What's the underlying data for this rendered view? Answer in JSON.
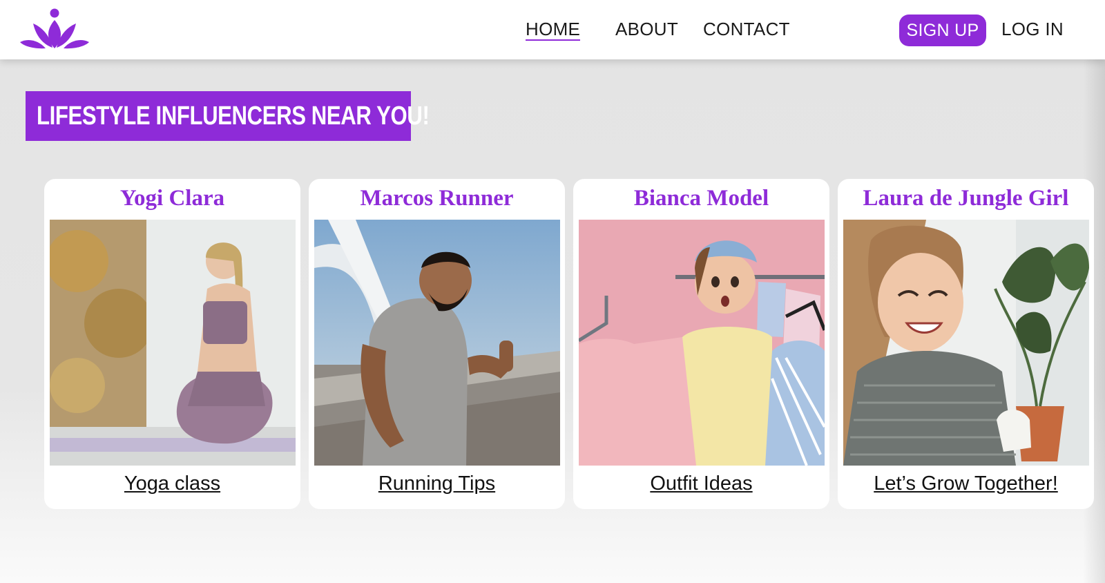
{
  "nav": {
    "logo": "lotus-logo-icon",
    "home": "HOME",
    "about": "ABOUT",
    "contact": "CONTACT",
    "signup": "SIGN UP",
    "login": "LOG IN"
  },
  "hero": {
    "title": "LIFESTYLE INFLUENCERS NEAR YOU!"
  },
  "cards": [
    {
      "name": "Yogi Clara",
      "link": "Yoga class"
    },
    {
      "name": "Marcos Runner",
      "link": "Running Tips"
    },
    {
      "name": "Bianca Model",
      "link": "Outfit Ideas"
    },
    {
      "name": "Laura de Jungle Girl",
      "link": "Let’s Grow Together!"
    }
  ],
  "colors": {
    "accent": "#8e2bd8",
    "background": "#e4e4e4",
    "card": "#ffffff"
  }
}
